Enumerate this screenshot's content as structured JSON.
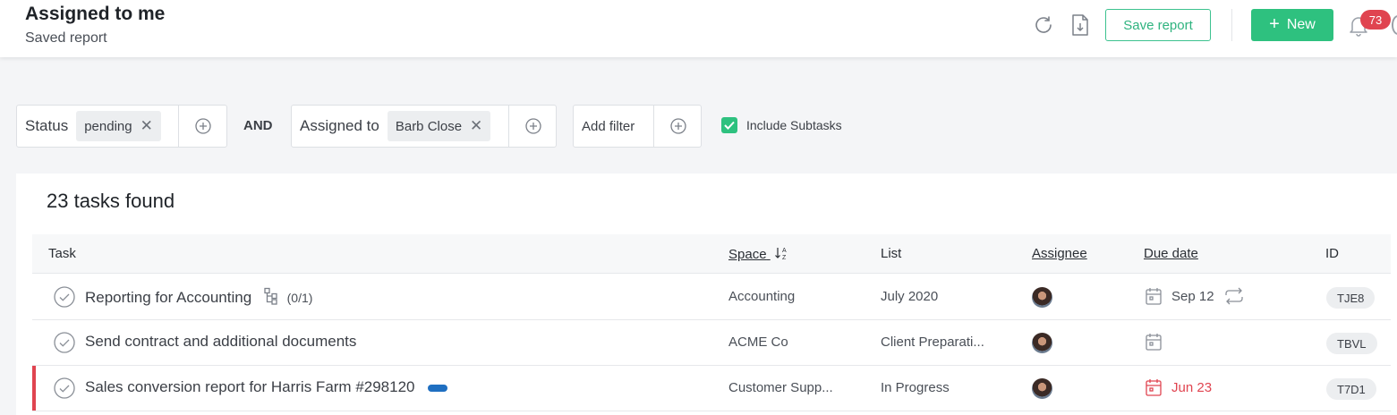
{
  "header": {
    "title": "Assigned to me",
    "subtitle": "Saved report",
    "save_label": "Save report",
    "new_label": "New",
    "notification_count": "73",
    "icons": [
      "refresh-icon",
      "export-icon",
      "bell-icon"
    ]
  },
  "filters": {
    "status_label": "Status",
    "status_value": "pending",
    "and_label": "AND",
    "assigned_label": "Assigned to",
    "assigned_value": "Barb Close",
    "add_filter_label": "Add filter",
    "include_subtasks_label": "Include Subtasks",
    "include_subtasks_checked": true
  },
  "results": {
    "count_label": "23 tasks found",
    "columns": {
      "task": "Task",
      "space": "Space",
      "list": "List",
      "assignee": "Assignee",
      "due": "Due date",
      "id": "ID"
    },
    "rows": [
      {
        "task": "Reporting for Accounting",
        "subtasks": "(0/1)",
        "space": "Accounting",
        "list": "July 2020",
        "due": "Sep 12",
        "recurring": true,
        "overdue": false,
        "id": "TJE8"
      },
      {
        "task": "Send contract and additional documents",
        "space": "ACME Co",
        "list": "Client Preparati...",
        "due": "",
        "overdue": false,
        "id": "TBVL"
      },
      {
        "task": "Sales conversion report for Harris Farm #298120",
        "space": "Customer Supp...",
        "list": "In Progress",
        "due": "Jun 23",
        "overdue": true,
        "id": "T7D1"
      }
    ]
  },
  "colors": {
    "accent": "#2ec17f",
    "danger": "#e04450",
    "tag_blue": "#1f6fc1"
  }
}
